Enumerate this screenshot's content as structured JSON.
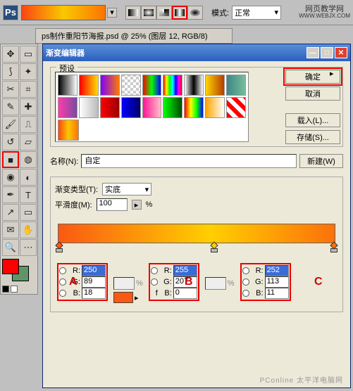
{
  "topbar": {
    "mode_label": "模式:",
    "mode_value": "正常",
    "watermark_top": "网页教学网",
    "watermark_url": "WWW.WEBJX.COM"
  },
  "doc_tab": "ps制作重阳节海报.psd @ 25% (图层 12, RGB/8)",
  "dialog": {
    "title": "渐变编辑器",
    "preset_label": "预设",
    "ok": "确定",
    "cancel": "取消",
    "load": "载入(L)...",
    "save": "存储(S)...",
    "name_label": "名称(N):",
    "name_value": "自定",
    "new_btn": "新建(W)",
    "type_label": "渐变类型(T):",
    "type_value": "实底",
    "smooth_label": "平滑度(M):",
    "smooth_value": "100",
    "percent": "%",
    "markers": {
      "a": "A",
      "b": "B",
      "c": "C"
    },
    "rgb_labels": {
      "r": "R:",
      "g": "G:",
      "b": "B:"
    },
    "stops": {
      "a": {
        "r": "250",
        "g": "89",
        "b": "18"
      },
      "b": {
        "r": "255",
        "g": "207",
        "b": "0"
      },
      "c": {
        "r": "252",
        "g": "113",
        "b": "11"
      }
    },
    "f_label": "f",
    "pct_placeholder": "%"
  },
  "footer_wm": "PConline  太平洋电脑网",
  "presets": [
    [
      "linear-gradient(90deg,#000,#fff)",
      "linear-gradient(90deg,#ff0000,#ffde00)",
      "linear-gradient(90deg,#7d00ff,#ff7a00)",
      "repeating-conic-gradient(#ccc 0 25%,#fff 0 50%) 0/8px 8px",
      "linear-gradient(90deg,#f00,#0f0,#00f)",
      "linear-gradient(90deg,#f00,#ff0,#0f0,#0ff,#00f,#f0f,#f00)",
      "linear-gradient(90deg,#fff,#000,#fff)",
      "linear-gradient(90deg,#ffd400,#b33e00)",
      "linear-gradient(90deg,#3b8686,#79bd9a)"
    ],
    [
      "linear-gradient(90deg,#ff3cac,#784ba0)",
      "linear-gradient(90deg,#fff,#bbb)",
      "linear-gradient(90deg,#ff0000,#990000)",
      "linear-gradient(90deg,#0000ff,#000066)",
      "linear-gradient(90deg,#ff1493,#ffc0cb)",
      "linear-gradient(90deg,#00ff00,#004d00)",
      "linear-gradient(90deg,#f00,#ff0,#0f0,#00f)",
      "linear-gradient(90deg,#ffa500,#fff)",
      "repeating-linear-gradient(45deg,#f00 0 6px,#fff 6px 12px)"
    ],
    [
      "linear-gradient(90deg,#fa4612,#fac800,#fc7400)"
    ]
  ]
}
